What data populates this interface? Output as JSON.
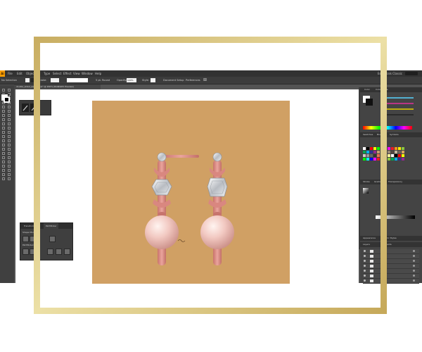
{
  "menubar": {
    "logo": "Ai",
    "items": [
      "File",
      "Edit",
      "Object",
      "Type",
      "Select",
      "Effect",
      "View",
      "Window",
      "Help"
    ],
    "workspace": "Essentials Classic"
  },
  "controlbar": {
    "selection": "No Selection",
    "stroke_label": "Stroke:",
    "brush": "5 pt. Round",
    "opacity_label": "Opacity:",
    "opacity_value": "100%",
    "style_label": "Style:",
    "document_setup": "Document Setup",
    "preferences": "Preferences"
  },
  "document_tab": {
    "title": "double_sided_earrings.ai* @ 200% (RGB/GPU Preview)"
  },
  "pathfinder": {
    "tabs": [
      "Transform",
      "Pathfinder"
    ],
    "shape_modes_label": "Shape Modes:",
    "pathfinders_label": "Pathfinders:"
  },
  "right_panels": {
    "color_tabs": [
      "Color",
      "Color Guide"
    ],
    "swatch_tabs": [
      "Swatches",
      "Brushes",
      "Symbols"
    ],
    "gradient_tabs": [
      "Stroke",
      "Gradient",
      "Transparency"
    ],
    "appearance_tabs": [
      "Appearance",
      "Graphic Styles"
    ],
    "layers_tabs": [
      "Layers",
      "Artboards"
    ]
  },
  "colors": {
    "artboard": "#d0a064",
    "metal": "#e8a19a",
    "metal_dark": "#c26f68",
    "pearl": "#f4d3cd",
    "gold_frame": "#d4c07a"
  }
}
